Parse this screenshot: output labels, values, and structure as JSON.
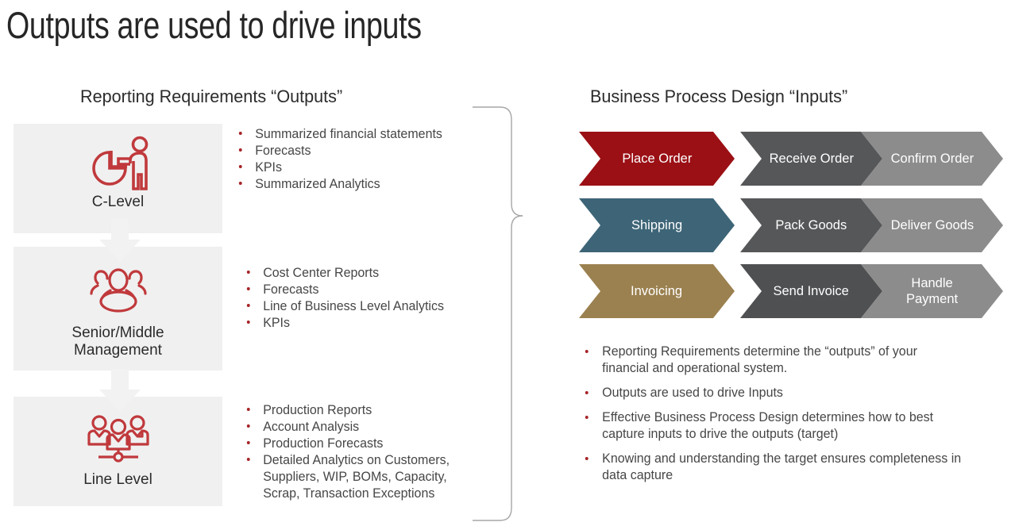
{
  "slide": {
    "title": "Outputs are used to drive inputs"
  },
  "left_column": {
    "heading": "Reporting Requirements “Outputs”",
    "levels": [
      {
        "label": "C-Level",
        "icon": "presenter-with-pie-chart-icon",
        "bullets": [
          "Summarized financial statements",
          "Forecasts",
          "KPIs",
          "Summarized Analytics"
        ]
      },
      {
        "label": "Senior/Middle\nManagement",
        "label_line1": "Senior/Middle",
        "label_line2": "Management",
        "icon": "three-people-group-icon",
        "bullets": [
          "Cost Center Reports",
          "Forecasts",
          "Line of Business Level Analytics",
          "KPIs"
        ]
      },
      {
        "label": "Line Level",
        "icon": "team-org-chart-icon",
        "bullets": [
          "Production Reports",
          "Account Analysis",
          "Production Forecasts",
          "Detailed Analytics on Customers, Suppliers, WIP, BOMs, Capacity, Scrap, Transaction Exceptions"
        ]
      }
    ],
    "flow_arrow_icon": "down-arrow-icon"
  },
  "connector": {
    "icon": "right-curly-brace-icon"
  },
  "right_column": {
    "heading": "Business Process Design “Inputs”",
    "process_rows": [
      {
        "steps": [
          {
            "label": "Place Order",
            "color": "#9b1015"
          },
          {
            "label": "Receive Order",
            "color": "#565759"
          },
          {
            "label": "Confirm Order",
            "color": "#8c8c8c"
          }
        ]
      },
      {
        "steps": [
          {
            "label": "Shipping",
            "color": "#3d6577"
          },
          {
            "label": "Pack Goods",
            "color": "#565759"
          },
          {
            "label": "Deliver Goods",
            "color": "#8c8c8c"
          }
        ]
      },
      {
        "steps": [
          {
            "label": "Invoicing",
            "color": "#9b8150"
          },
          {
            "label": "Send Invoice",
            "color": "#4f5052"
          },
          {
            "label": "Handle\nPayment",
            "color": "#8c8c8c"
          }
        ]
      }
    ],
    "bullets": [
      "Reporting Requirements determine the “outputs” of your financial and operational system.",
      "Outputs are used to drive Inputs",
      "Effective Business Process Design determines how to best capture inputs to drive the outputs (target)",
      "Knowing and understanding the target ensures completeness in data capture"
    ]
  },
  "colors": {
    "accent_red": "#a52427",
    "icon_red": "#c0393c",
    "box_gray": "#f0f0f0",
    "arrow_gray": "#f2f2f2",
    "brace_gray": "#a6a6a6",
    "text_gray": "#464646",
    "title_black": "#262626"
  }
}
